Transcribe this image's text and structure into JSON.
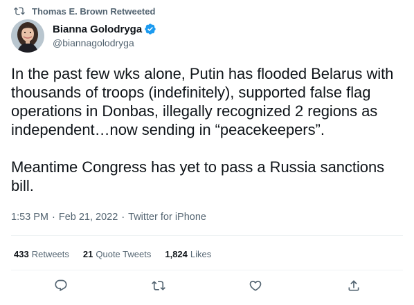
{
  "retweet_context": {
    "label": "Thomas E. Brown Retweeted",
    "icon": "retweet-icon"
  },
  "author": {
    "name": "Bianna Golodryga",
    "handle": "@biannagolodryga",
    "verified": true,
    "verified_icon": "verified-badge-icon"
  },
  "tweet": {
    "text": "In the past few wks alone, Putin has flooded Belarus with thousands of troops (indefinitely), supported false flag operations in Donbas, illegally recognized 2 regions as independent…now sending in “peacekeepers”.\n\nMeantime Congress has yet to pass a Russia sanctions bill."
  },
  "meta": {
    "time": "1:53 PM",
    "separator": "·",
    "date": "Feb 21, 2022",
    "source": "Twitter for iPhone"
  },
  "stats": {
    "retweets": {
      "count": "433",
      "label": "Retweets"
    },
    "quote_tweets": {
      "count": "21",
      "label": "Quote Tweets"
    },
    "likes": {
      "count": "1,824",
      "label": "Likes"
    }
  },
  "actions": {
    "reply_icon": "reply-icon",
    "retweet_icon": "retweet-icon",
    "like_icon": "heart-icon",
    "share_icon": "share-icon"
  },
  "colors": {
    "text_primary": "#0f1419",
    "text_secondary": "#536471",
    "verified_blue": "#1d9bf0",
    "divider": "#eff3f4"
  }
}
